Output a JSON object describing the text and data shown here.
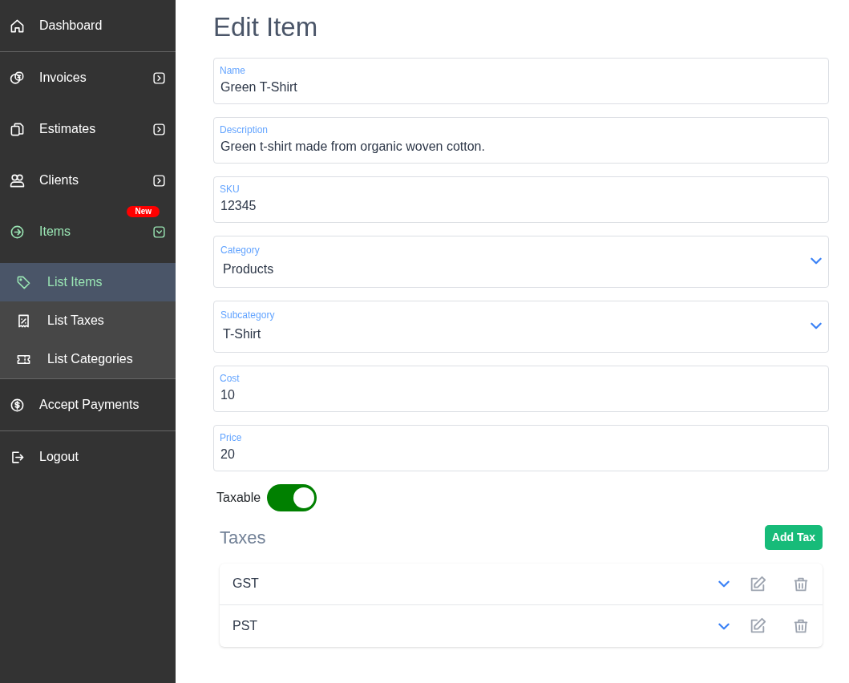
{
  "sidebar": {
    "items": [
      {
        "label": "Dashboard",
        "has_submenu": false,
        "selected": false
      },
      {
        "label": "Invoices",
        "has_submenu": true,
        "expanded": false,
        "selected": false
      },
      {
        "label": "Estimates",
        "has_submenu": true,
        "expanded": false,
        "selected": false
      },
      {
        "label": "Clients",
        "has_submenu": true,
        "expanded": false,
        "selected": false
      },
      {
        "label": "Items",
        "has_submenu": true,
        "expanded": true,
        "selected": true,
        "badge": "New",
        "children": [
          {
            "label": "List Items",
            "selected": true
          },
          {
            "label": "List Taxes",
            "selected": false
          },
          {
            "label": "List Categories",
            "selected": false
          }
        ]
      },
      {
        "label": "Accept Payments",
        "has_submenu": false,
        "selected": false
      },
      {
        "label": "Logout",
        "has_submenu": false,
        "selected": false
      }
    ]
  },
  "page": {
    "title": "Edit Item"
  },
  "fields": [
    {
      "kind": "text",
      "label": "Name",
      "value": "Green T-Shirt"
    },
    {
      "kind": "text",
      "label": "Description",
      "value": "Green t-shirt made from organic woven cotton."
    },
    {
      "kind": "text",
      "label": "SKU",
      "value": "12345"
    },
    {
      "kind": "select",
      "label": "Category",
      "value": "Products"
    },
    {
      "kind": "select",
      "label": "Subcategory",
      "value": "T-Shirt"
    },
    {
      "kind": "text",
      "label": "Cost",
      "value": "10"
    },
    {
      "kind": "text",
      "label": "Price",
      "value": "20"
    }
  ],
  "taxable": {
    "label": "Taxable",
    "on": true
  },
  "taxes": {
    "title": "Taxes",
    "add_button": "Add Tax",
    "rows": [
      {
        "name": "GST"
      },
      {
        "name": "PST"
      }
    ]
  }
}
